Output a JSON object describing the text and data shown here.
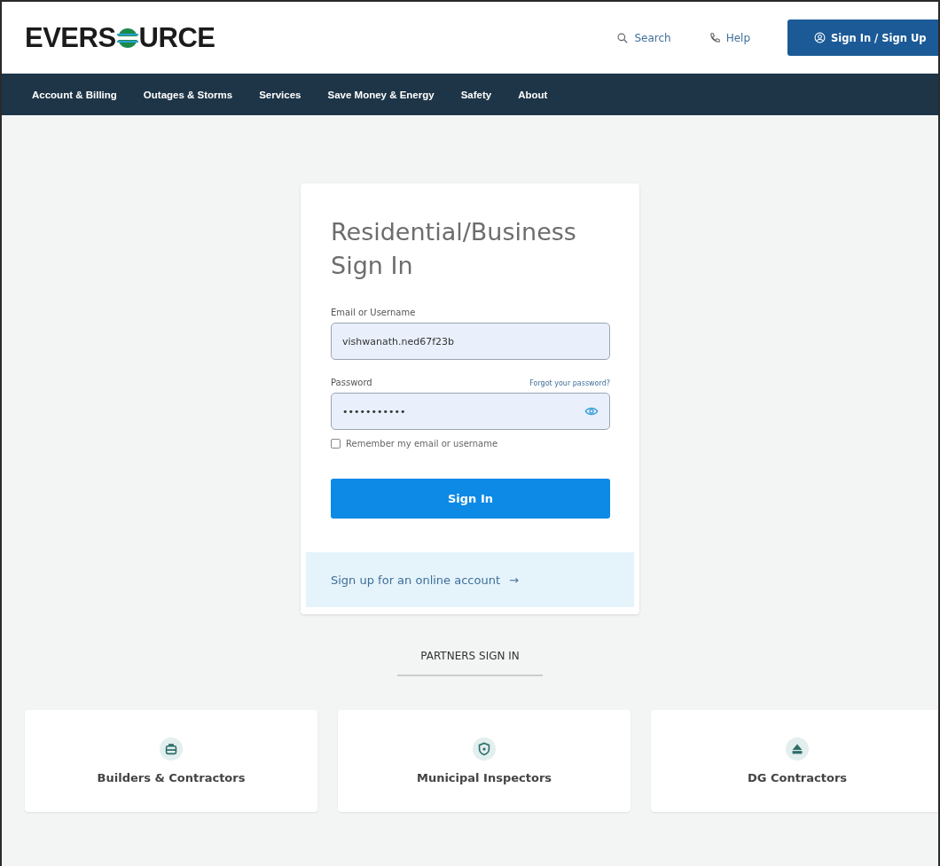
{
  "header": {
    "logo": "EVERS",
    "logo_end": "URCE",
    "search": "Search",
    "help": "Help",
    "sign_in": "Sign In / Sign Up"
  },
  "nav": {
    "items": [
      "Account & Billing",
      "Outages & Storms",
      "Services",
      "Save Money & Energy",
      "Safety",
      "About"
    ]
  },
  "login": {
    "title": "Residential/Business Sign In",
    "email": {
      "label": "Email or Username",
      "value": "vishwanath.ned67f23b"
    },
    "password": {
      "label": "Password",
      "value": "•••••••••••",
      "forgot": "Forgot your password?"
    },
    "remember": {
      "label": "Remember my email or username",
      "checked": false
    },
    "submit": "Sign In",
    "signup": "Sign up for an online account",
    "signup_arrow": "→"
  },
  "partners": {
    "heading": "PARTNERS SIGN IN",
    "items": [
      "Builders & Contractors",
      "Municipal Inspectors",
      "DG Contractors"
    ]
  }
}
